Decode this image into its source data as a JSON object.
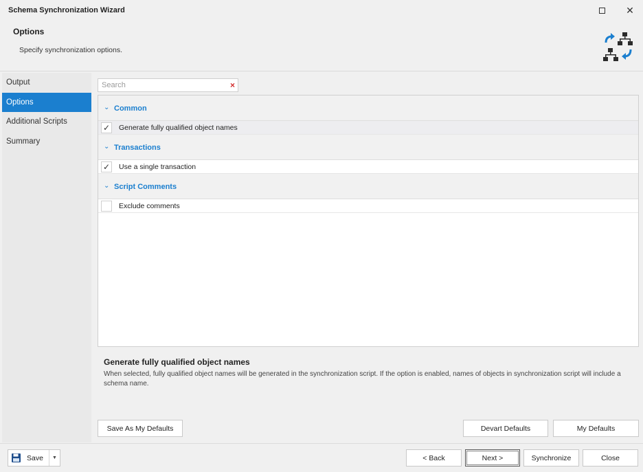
{
  "window": {
    "title": "Schema Synchronization Wizard"
  },
  "header": {
    "title": "Options",
    "subtitle": "Specify synchronization options."
  },
  "sidebar": {
    "items": [
      {
        "label": "Output"
      },
      {
        "label": "Options"
      },
      {
        "label": "Additional Scripts"
      },
      {
        "label": "Summary"
      }
    ],
    "active_index": 1
  },
  "search": {
    "placeholder": "Search",
    "value": ""
  },
  "option_groups": [
    {
      "label": "Common",
      "options": [
        {
          "label": "Generate fully qualified object names",
          "checked": true,
          "selected": true
        }
      ]
    },
    {
      "label": "Transactions",
      "options": [
        {
          "label": "Use a single transaction",
          "checked": true,
          "selected": false
        }
      ]
    },
    {
      "label": "Script Comments",
      "options": [
        {
          "label": "Exclude comments",
          "checked": false,
          "selected": false
        }
      ]
    }
  ],
  "description": {
    "title": "Generate fully qualified object names",
    "text": "When selected, fully qualified object names will be generated in the synchronization script. If the option is enabled, names of objects in synchronization script will include a schema name."
  },
  "defaults_buttons": {
    "save_as_my_defaults": "Save As My Defaults",
    "devart_defaults": "Devart Defaults",
    "my_defaults": "My Defaults"
  },
  "footer": {
    "save": "Save",
    "back": "< Back",
    "next": "Next >",
    "synchronize": "Synchronize",
    "close": "Close"
  },
  "icons": {
    "maximize": "maximize-icon",
    "close": "close-icon",
    "header": "schema-sync-icon",
    "search_clear": "clear-search-icon",
    "save": "floppy-disk-icon",
    "save_dropdown": "chevron-down-icon"
  },
  "colors": {
    "accent": "#1b7fcf",
    "clear": "#d12d2d"
  }
}
